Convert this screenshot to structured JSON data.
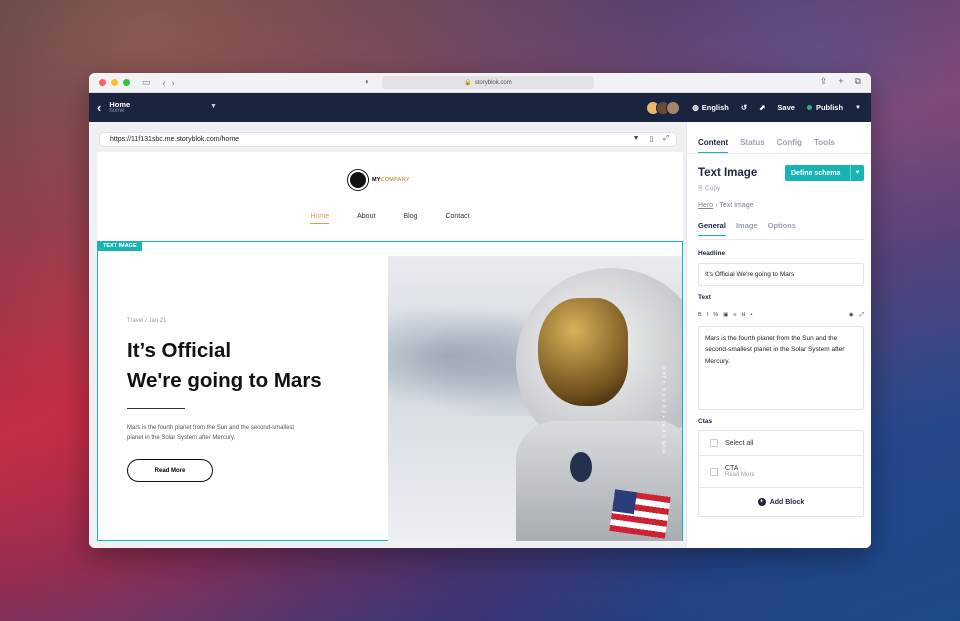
{
  "browser": {
    "url": "storyblok.com"
  },
  "header": {
    "story_title": "Home",
    "story_slug": "home",
    "language": "English",
    "save_label": "Save",
    "publish_label": "Publish"
  },
  "preview": {
    "url": "https://11f131sbc.me.storyblok.com/home",
    "logo_my": "MY",
    "logo_company": "COMPANY",
    "nav": [
      "Home",
      "About",
      "Blog",
      "Contact"
    ],
    "block_tag": "TEXT IMAGE",
    "meta": "Travel / Jan 21",
    "headline_line1": "It’s Official",
    "headline_line2": "We're going to Mars",
    "body": "Mars is the fourth planet from the Sun and the second-smallest planet in the Solar System after Mercury.",
    "button": "Read More",
    "image_caption": "0.87 c. 0 x 2 0.2 • 1a 4 0 NCH"
  },
  "editor": {
    "tabs": [
      "Content",
      "Status",
      "Config",
      "Tools"
    ],
    "component_title": "Text Image",
    "define_schema": "Define schema",
    "copy": "Copy",
    "breadcrumb_parent": "Hero",
    "breadcrumb_current": "Text Image",
    "subtabs": [
      "General",
      "Image",
      "Options"
    ],
    "headline_label": "Headline",
    "headline_value": "It's Official We're going to Mars",
    "text_label": "Text",
    "text_value": "Mars is the fourth planet from the Sun and the second-smallest planet in the Solar System after Mercury.",
    "ctas_label": "Ctas",
    "select_all": "Select all",
    "cta_name": "CTA",
    "cta_sub": "Read More",
    "add_block": "Add Block"
  },
  "colors": {
    "accent": "#18b4b4",
    "header_bg": "#1b243f",
    "brand_orange": "#d89a4e",
    "publish_dot": "#2db47d"
  }
}
